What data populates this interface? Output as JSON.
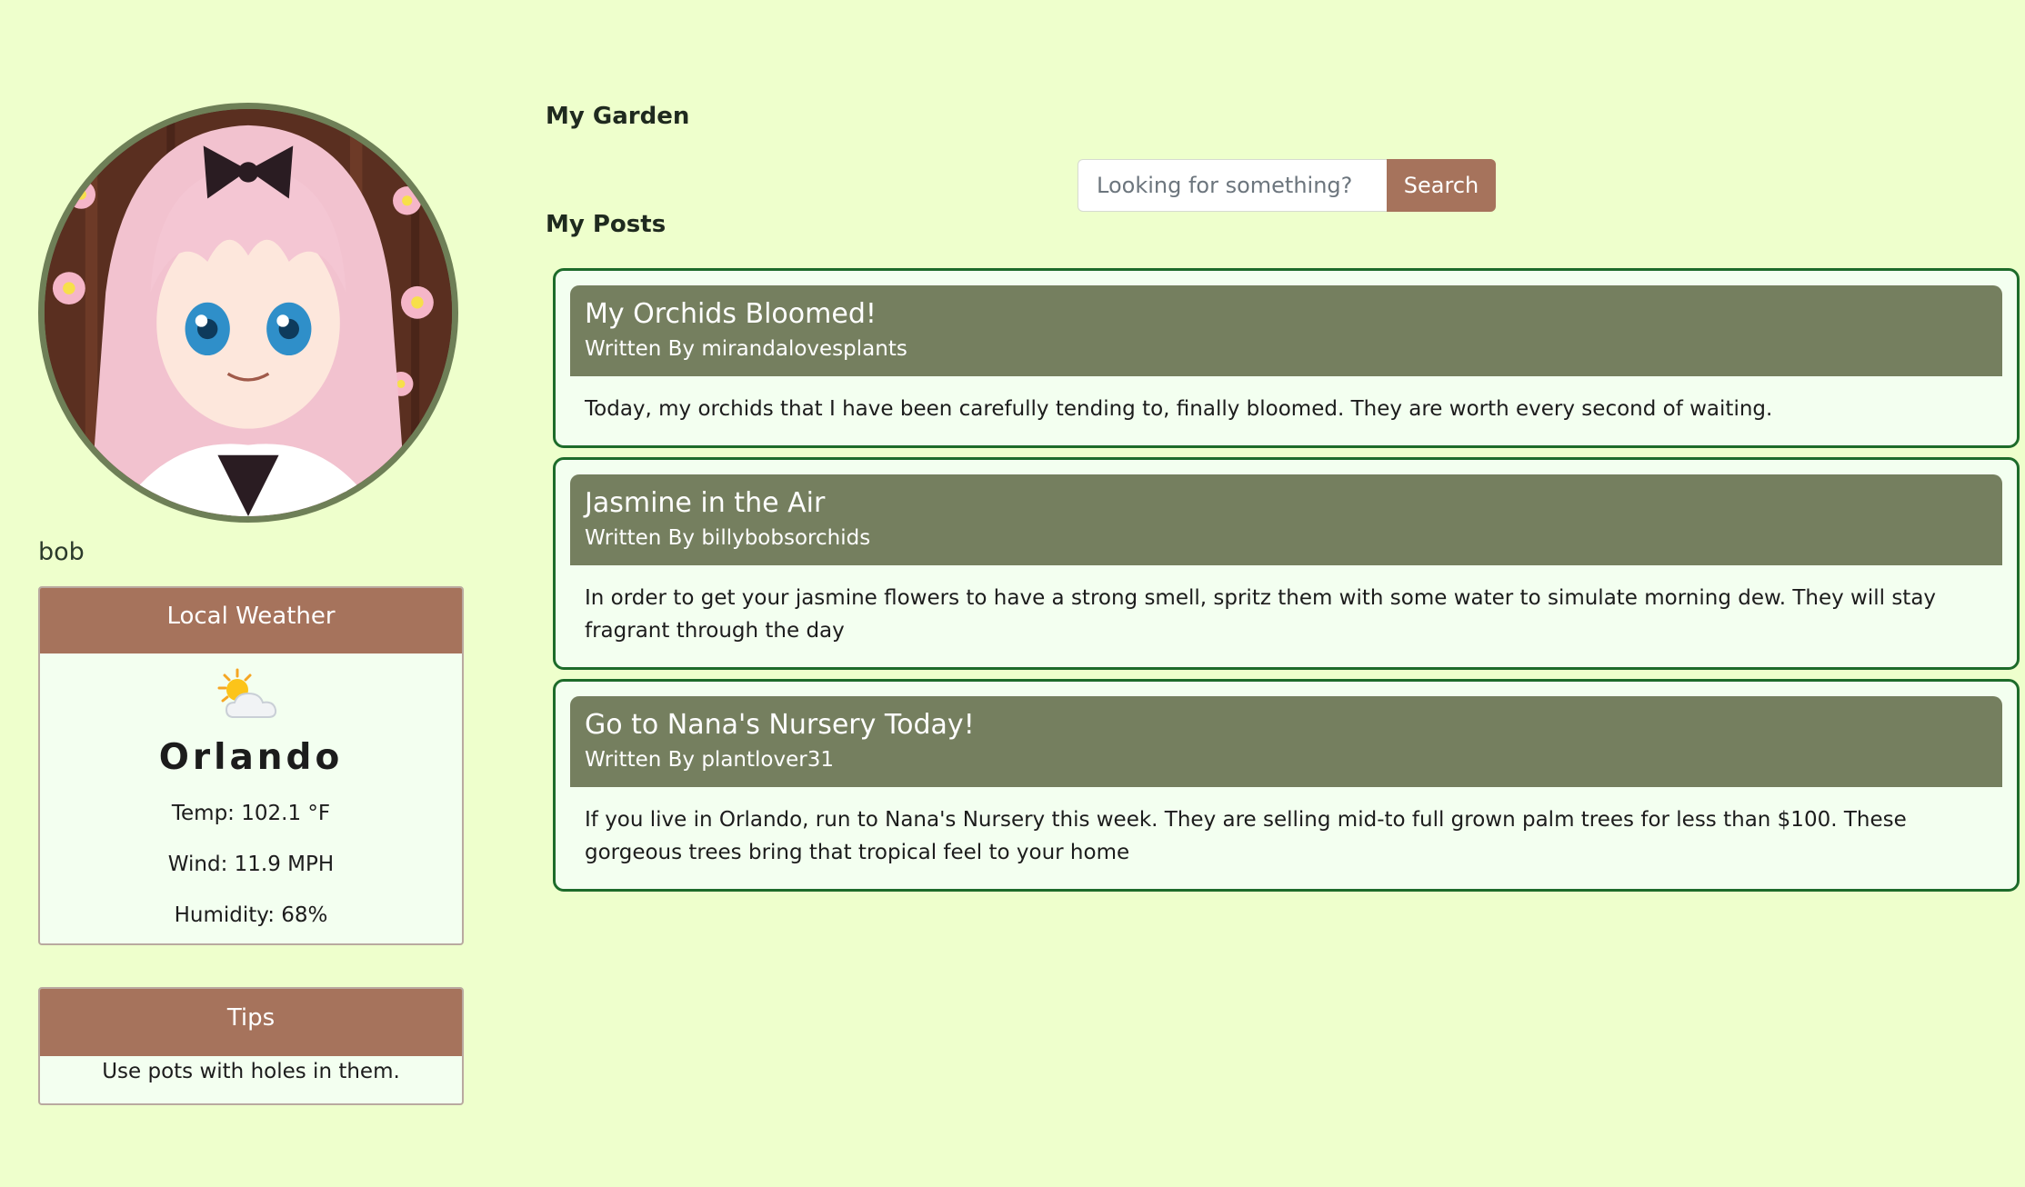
{
  "profile": {
    "username": "bob",
    "avatar_alt": "profile-avatar"
  },
  "weather": {
    "header": "Local Weather",
    "icon": "sun-behind-cloud-icon",
    "city": "Orlando",
    "temp": "Temp: 102.1 °F",
    "wind": "Wind: 11.9 MPH",
    "humidity": "Humidity: 68%"
  },
  "tips": {
    "header": "Tips",
    "text": "Use pots with holes in them."
  },
  "main": {
    "garden_title": "My Garden",
    "posts_title": "My Posts"
  },
  "search": {
    "placeholder": "Looking for something?",
    "value": "",
    "button_label": "Search"
  },
  "posts": [
    {
      "title": "My Orchids Bloomed!",
      "author": "Written By mirandalovesplants",
      "body": "Today, my orchids that I have been carefully tending to, finally bloomed. They are worth every second of waiting."
    },
    {
      "title": "Jasmine in the Air",
      "author": "Written By billybobsorchids",
      "body": "In order to get your jasmine flowers to have a strong smell, spritz them with some water to simulate morning dew. They will stay fragrant through the day"
    },
    {
      "title": "Go to Nana's Nursery Today!",
      "author": "Written By plantlover31",
      "body": "If you live in Orlando, run to Nana's Nursery this week. They are selling mid-to full grown palm trees for less than $100. These gorgeous trees bring that tropical feel to your home"
    }
  ],
  "colors": {
    "page_background": "#eeffcc",
    "accent_brown": "#a6735c",
    "post_header": "#757f5f",
    "post_border": "#1d6b2a",
    "avatar_border": "#6e7f57"
  }
}
